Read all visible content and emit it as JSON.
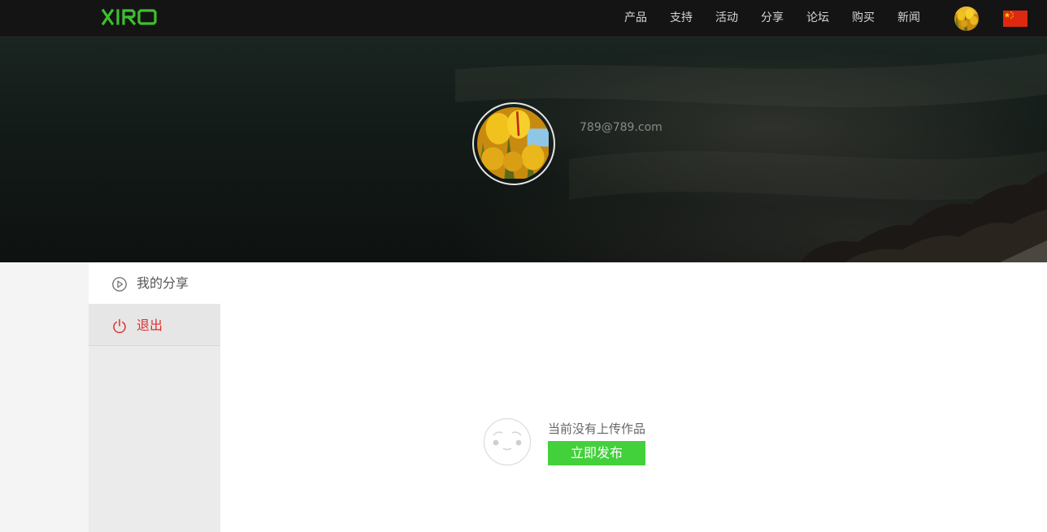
{
  "header": {
    "logo_text": "XIRO",
    "nav": [
      "产品",
      "支持",
      "活动",
      "分享",
      "论坛",
      "购买",
      "新闻"
    ],
    "avatar_icon": "tulip-avatar",
    "language_icon": "china-flag-icon"
  },
  "profile": {
    "email": "789@789.com",
    "avatar_icon": "tulip-avatar"
  },
  "sidebar": {
    "items": [
      {
        "label": "我的分享",
        "icon": "play-circle-icon",
        "selected": true
      },
      {
        "label": "退出",
        "icon": "power-icon",
        "selected": false
      }
    ]
  },
  "main": {
    "empty_message": "当前没有上传作品",
    "publish_label": "立即发布",
    "empty_icon": "sad-face-icon"
  },
  "colors": {
    "brand_green": "#3fbf2e",
    "publish_button": "#42d13a",
    "logout_red": "#e02e2e",
    "topbar": "#141414"
  }
}
